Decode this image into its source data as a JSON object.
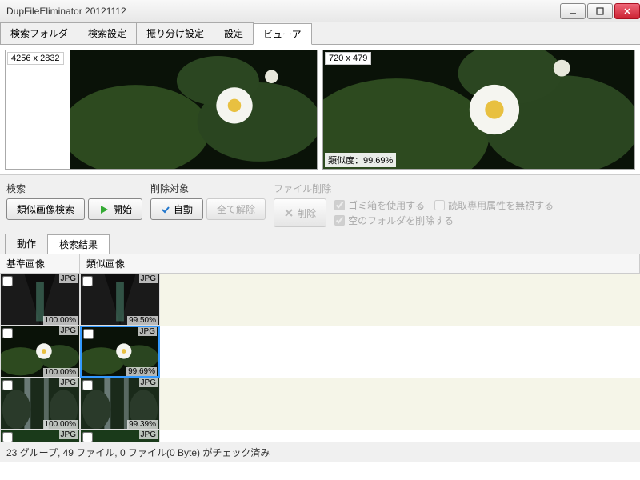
{
  "window": {
    "title": "DupFileEliminator 20121112"
  },
  "tabs": {
    "items": [
      "検索フォルダ",
      "検索設定",
      "振り分け設定",
      "設定",
      "ビューア"
    ],
    "active": 4
  },
  "viewer": {
    "left": {
      "dimensions": "4256 x 2832"
    },
    "right": {
      "dimensions": "720 x 479",
      "similarity_label": "類似度：99.69%"
    }
  },
  "controls": {
    "search": {
      "label": "検索",
      "similar_btn": "類似画像検索",
      "start_btn": "開始"
    },
    "delete_target": {
      "label": "削除対象",
      "auto_btn": "自動",
      "clear_btn": "全て解除"
    },
    "file_delete": {
      "label": "ファイル削除",
      "delete_btn": "削除",
      "use_trash": "ゴミ箱を使用する",
      "ignore_readonly": "読取専用属性を無視する",
      "delete_empty": "空のフォルダを削除する"
    }
  },
  "sub_tabs": {
    "items": [
      "動作",
      "検索結果"
    ],
    "active": 1
  },
  "results": {
    "cols": {
      "ref": "基準画像",
      "similar": "類似画像"
    },
    "rows": [
      {
        "ref": {
          "ext": "JPG",
          "pct": "100.00%",
          "img": "cave"
        },
        "sim": {
          "ext": "JPG",
          "pct": "99.50%",
          "img": "cave"
        }
      },
      {
        "ref": {
          "ext": "JPG",
          "pct": "100.00%",
          "img": "lily"
        },
        "sim": {
          "ext": "JPG",
          "pct": "99.69%",
          "img": "lily",
          "selected": true
        }
      },
      {
        "ref": {
          "ext": "JPG",
          "pct": "100.00%",
          "img": "falls"
        },
        "sim": {
          "ext": "JPG",
          "pct": "99.39%",
          "img": "falls"
        }
      },
      {
        "ref": {
          "ext": "JPG",
          "pct": "",
          "img": "forest"
        },
        "sim": {
          "ext": "JPG",
          "pct": "",
          "img": "forest"
        }
      }
    ]
  },
  "status": "23 グループ, 49 ファイル, 0 ファイル(0 Byte) がチェック済み"
}
